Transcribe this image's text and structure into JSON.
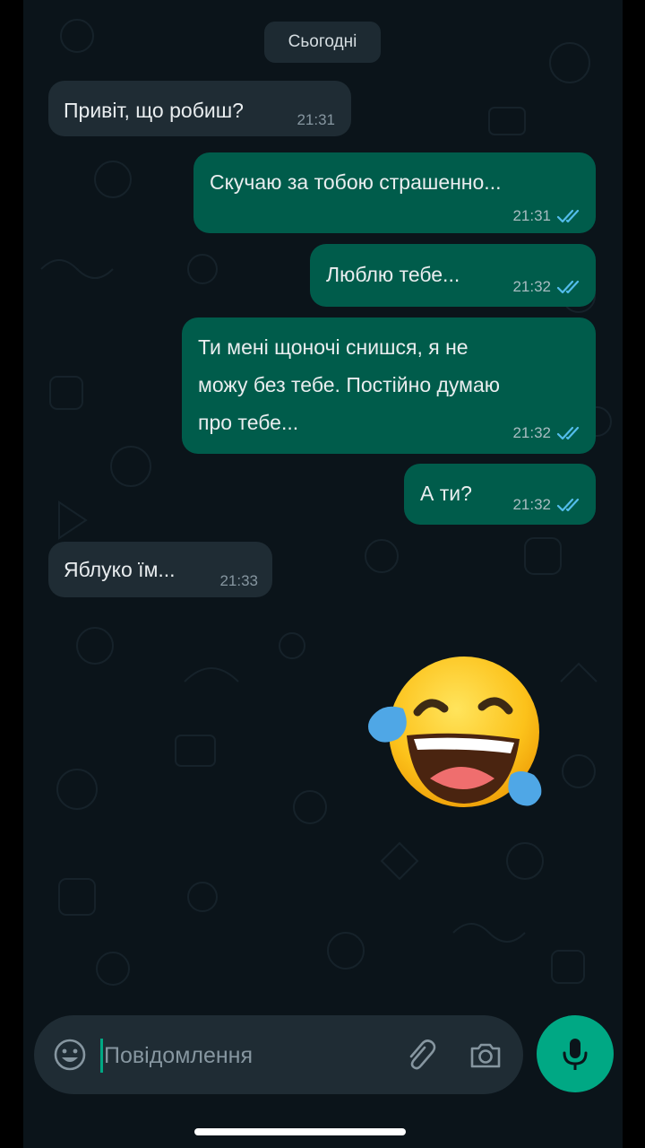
{
  "colors": {
    "background": "#0b141a",
    "incoming_bubble": "#1f2c34",
    "outgoing_bubble": "#005c4b",
    "read_ticks": "#53bdeb",
    "accent": "#00a884"
  },
  "chat": {
    "date_label": "Сьогодні",
    "messages": [
      {
        "direction": "incoming",
        "text": "Привіт, що робиш?",
        "time": "21:31"
      },
      {
        "direction": "outgoing",
        "text": "Скучаю за тобою страшенно...",
        "time": "21:31",
        "status": "read"
      },
      {
        "direction": "outgoing",
        "text": "Люблю тебе...",
        "time": "21:32",
        "status": "read"
      },
      {
        "direction": "outgoing",
        "lines": [
          "Ти мені щоночі снишся, я не",
          "можу без тебе. Постійно думаю",
          "про тебе..."
        ],
        "time": "21:32",
        "status": "read"
      },
      {
        "direction": "outgoing",
        "text": "А ти?",
        "time": "21:32",
        "status": "read"
      },
      {
        "direction": "incoming",
        "text": "Яблуко їм...",
        "time": "21:33"
      }
    ],
    "overlay_emoji": "face-with-tears-of-joy"
  },
  "composer": {
    "placeholder": "Повідомлення",
    "value": "",
    "icons": [
      "smiley-icon",
      "paperclip-icon",
      "camera-icon",
      "microphone-icon"
    ]
  }
}
